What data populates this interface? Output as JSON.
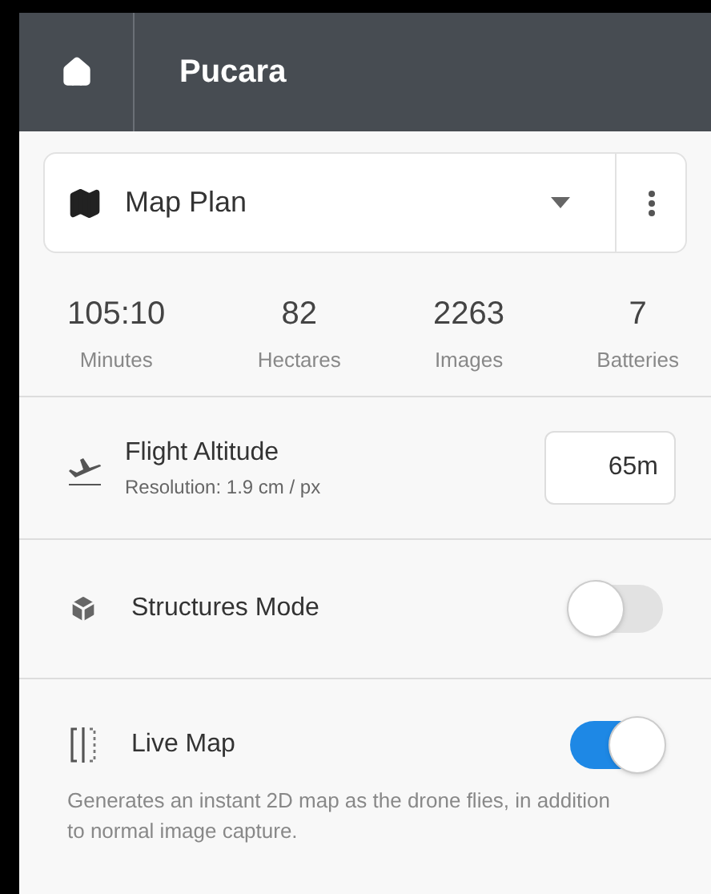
{
  "header": {
    "title": "Pucara"
  },
  "plan_selector": {
    "label": "Map Plan"
  },
  "stats": [
    {
      "value": "105:10",
      "label": "Minutes"
    },
    {
      "value": "82",
      "label": "Hectares"
    },
    {
      "value": "2263",
      "label": "Images"
    },
    {
      "value": "7",
      "label": "Batteries"
    }
  ],
  "settings": [
    {
      "kind": "input",
      "label": "Flight Altitude",
      "sublabel_key": "Resolution:",
      "sublabel_value": "1.9 cm / px",
      "value": "65m"
    },
    {
      "kind": "toggle",
      "label": "Structures Mode",
      "on": false
    },
    {
      "kind": "toggle",
      "label": "Live Map",
      "on": true,
      "description": "Generates an instant 2D map as the drone flies, in addition to normal image capture."
    }
  ]
}
